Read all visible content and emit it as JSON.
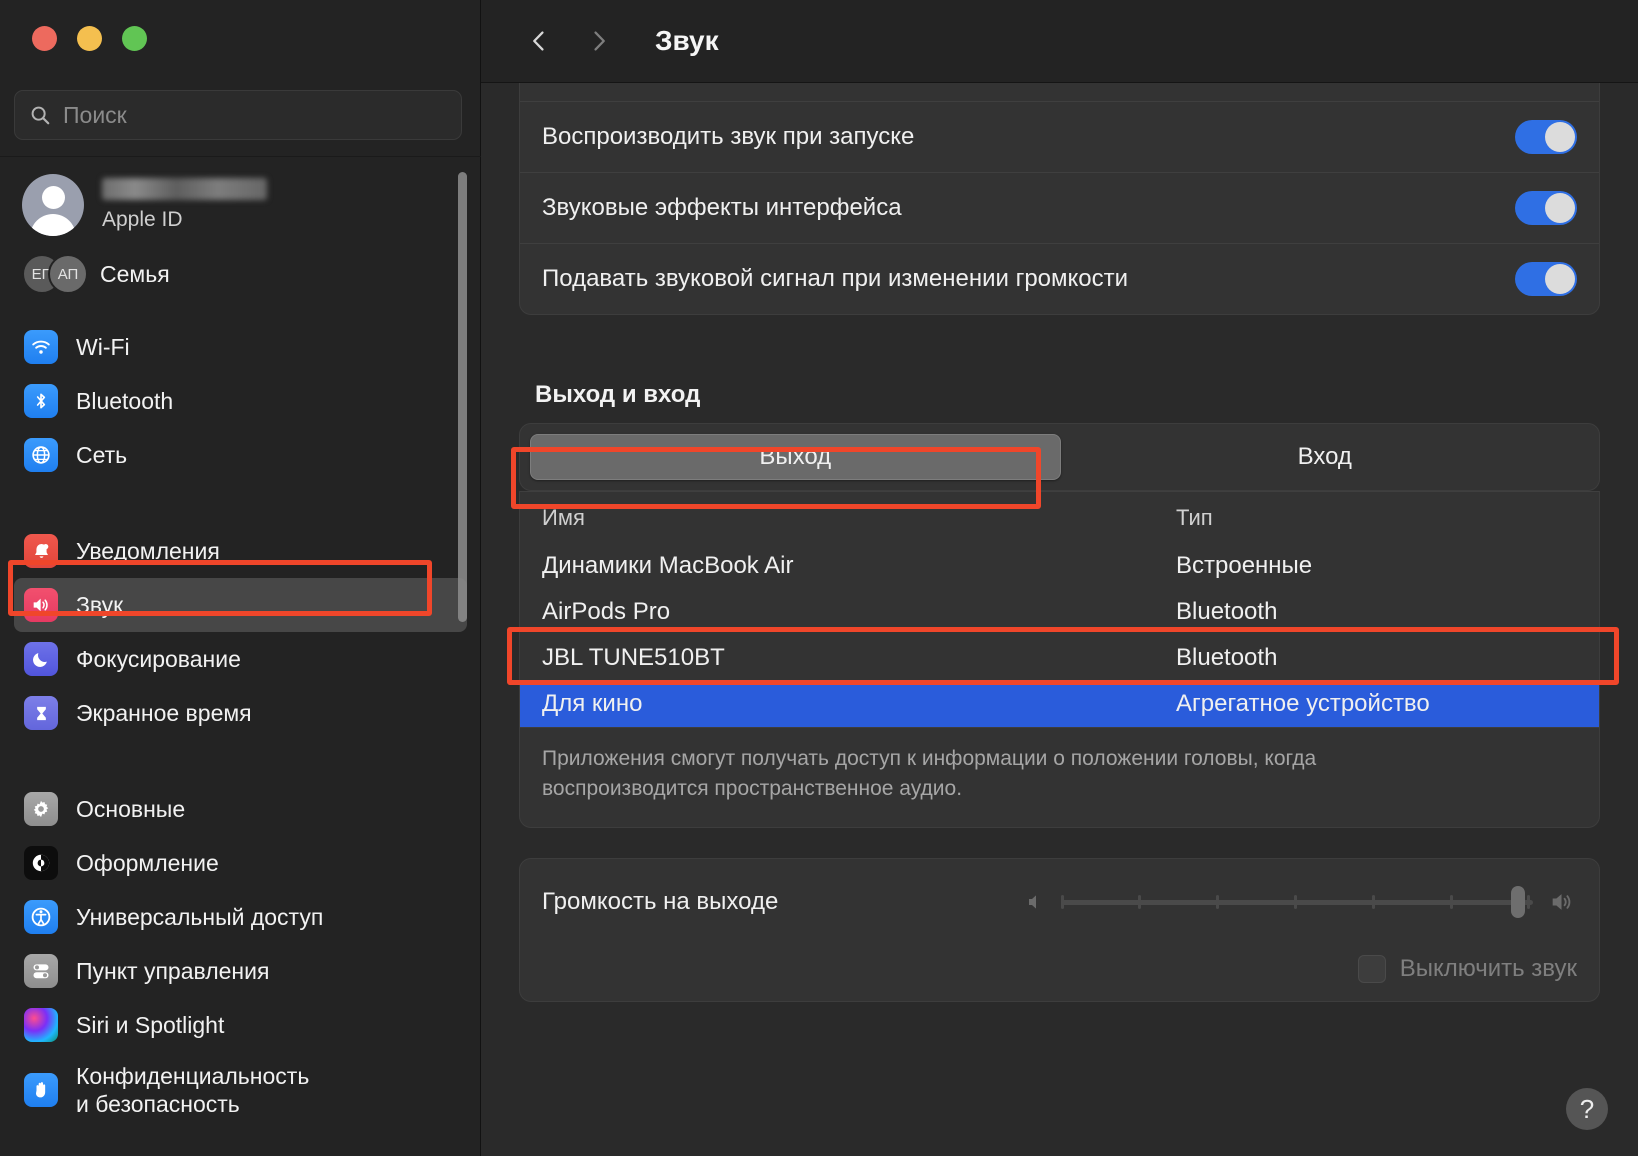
{
  "window": {
    "traffic_lights": [
      "close",
      "minimize",
      "zoom"
    ],
    "colors": {
      "close": "#ed6a5e",
      "minimize": "#f4bf4f",
      "zoom": "#61c554",
      "accent_blue": "#2f6fe4",
      "selection_blue": "#2a5cdb",
      "highlight_red": "#f0462a",
      "sidebar_bg": "#232323",
      "main_bg": "#2a2a2a",
      "card_bg": "#333333"
    }
  },
  "sidebar": {
    "search": {
      "placeholder": "Поиск",
      "value": "",
      "icon": "search-icon"
    },
    "account": {
      "name_redacted": "",
      "subtitle": "Apple ID",
      "avatar": "person-avatar"
    },
    "family": {
      "label": "Семья",
      "badges": [
        "ЕП",
        "АП"
      ]
    },
    "groups": [
      {
        "items": [
          {
            "label": "Wi-Fi",
            "icon": "wifi-icon",
            "selected": false
          },
          {
            "label": "Bluetooth",
            "icon": "bluetooth-icon",
            "selected": false
          },
          {
            "label": "Сеть",
            "icon": "network-globe-icon",
            "selected": false
          }
        ]
      },
      {
        "items": [
          {
            "label": "Уведомления",
            "icon": "notifications-bell-icon",
            "selected": false
          },
          {
            "label": "Звук",
            "icon": "sound-speaker-icon",
            "selected": true
          },
          {
            "label": "Фокусирование",
            "icon": "focus-moon-icon",
            "selected": false
          },
          {
            "label": "Экранное время",
            "icon": "screen-time-hourglass-icon",
            "selected": false
          }
        ]
      },
      {
        "items": [
          {
            "label": "Основные",
            "icon": "general-gear-icon",
            "selected": false
          },
          {
            "label": "Оформление",
            "icon": "appearance-contrast-icon",
            "selected": false
          },
          {
            "label": "Универсальный доступ",
            "icon": "accessibility-icon",
            "selected": false
          },
          {
            "label": "Пункт управления",
            "icon": "control-center-icon",
            "selected": false
          },
          {
            "label": "Siri и Spotlight",
            "icon": "siri-orb-icon",
            "selected": false
          },
          {
            "label": "Конфиденциальность\nи безопасность",
            "label_line1": "Конфиденциальность",
            "label_line2": "и безопасность",
            "icon": "privacy-hand-icon",
            "selected": false
          }
        ]
      }
    ]
  },
  "header": {
    "back_icon": "chevron-left-icon",
    "forward_icon": "chevron-right-icon",
    "title": "Звук"
  },
  "main": {
    "toggles": [
      {
        "label": "Воспроизводить звук при запуске",
        "on": true
      },
      {
        "label": "Звуковые эффекты интерфейса",
        "on": true
      },
      {
        "label": "Подавать звуковой сигнал при изменении громкости",
        "on": true
      }
    ],
    "io_section": {
      "title": "Выход и вход",
      "tabs": [
        {
          "label": "Выход",
          "active": true
        },
        {
          "label": "Вход",
          "active": false
        }
      ],
      "columns": [
        "Имя",
        "Тип"
      ],
      "devices": [
        {
          "name": "Динамики MacBook Air",
          "type": "Встроенные",
          "selected": false
        },
        {
          "name": "AirPods Pro",
          "type": "Bluetooth",
          "selected": false
        },
        {
          "name": "JBL TUNE510BT",
          "type": "Bluetooth",
          "selected": false
        },
        {
          "name": "Для кино",
          "type": "Агрегатное устройство",
          "selected": true
        }
      ],
      "note_line1": "Приложения смогут получать доступ к информации о положении головы, когда",
      "note_line2": "воспроизводится пространственное аудио."
    },
    "volume": {
      "label": "Громкость на выходе",
      "value_percent": 97,
      "low_icon": "speaker-low-icon",
      "high_icon": "speaker-high-icon",
      "mute": {
        "label": "Выключить звук",
        "checked": false,
        "disabled": true
      }
    },
    "help_button": {
      "label": "?",
      "icon": "help-question-icon"
    }
  }
}
